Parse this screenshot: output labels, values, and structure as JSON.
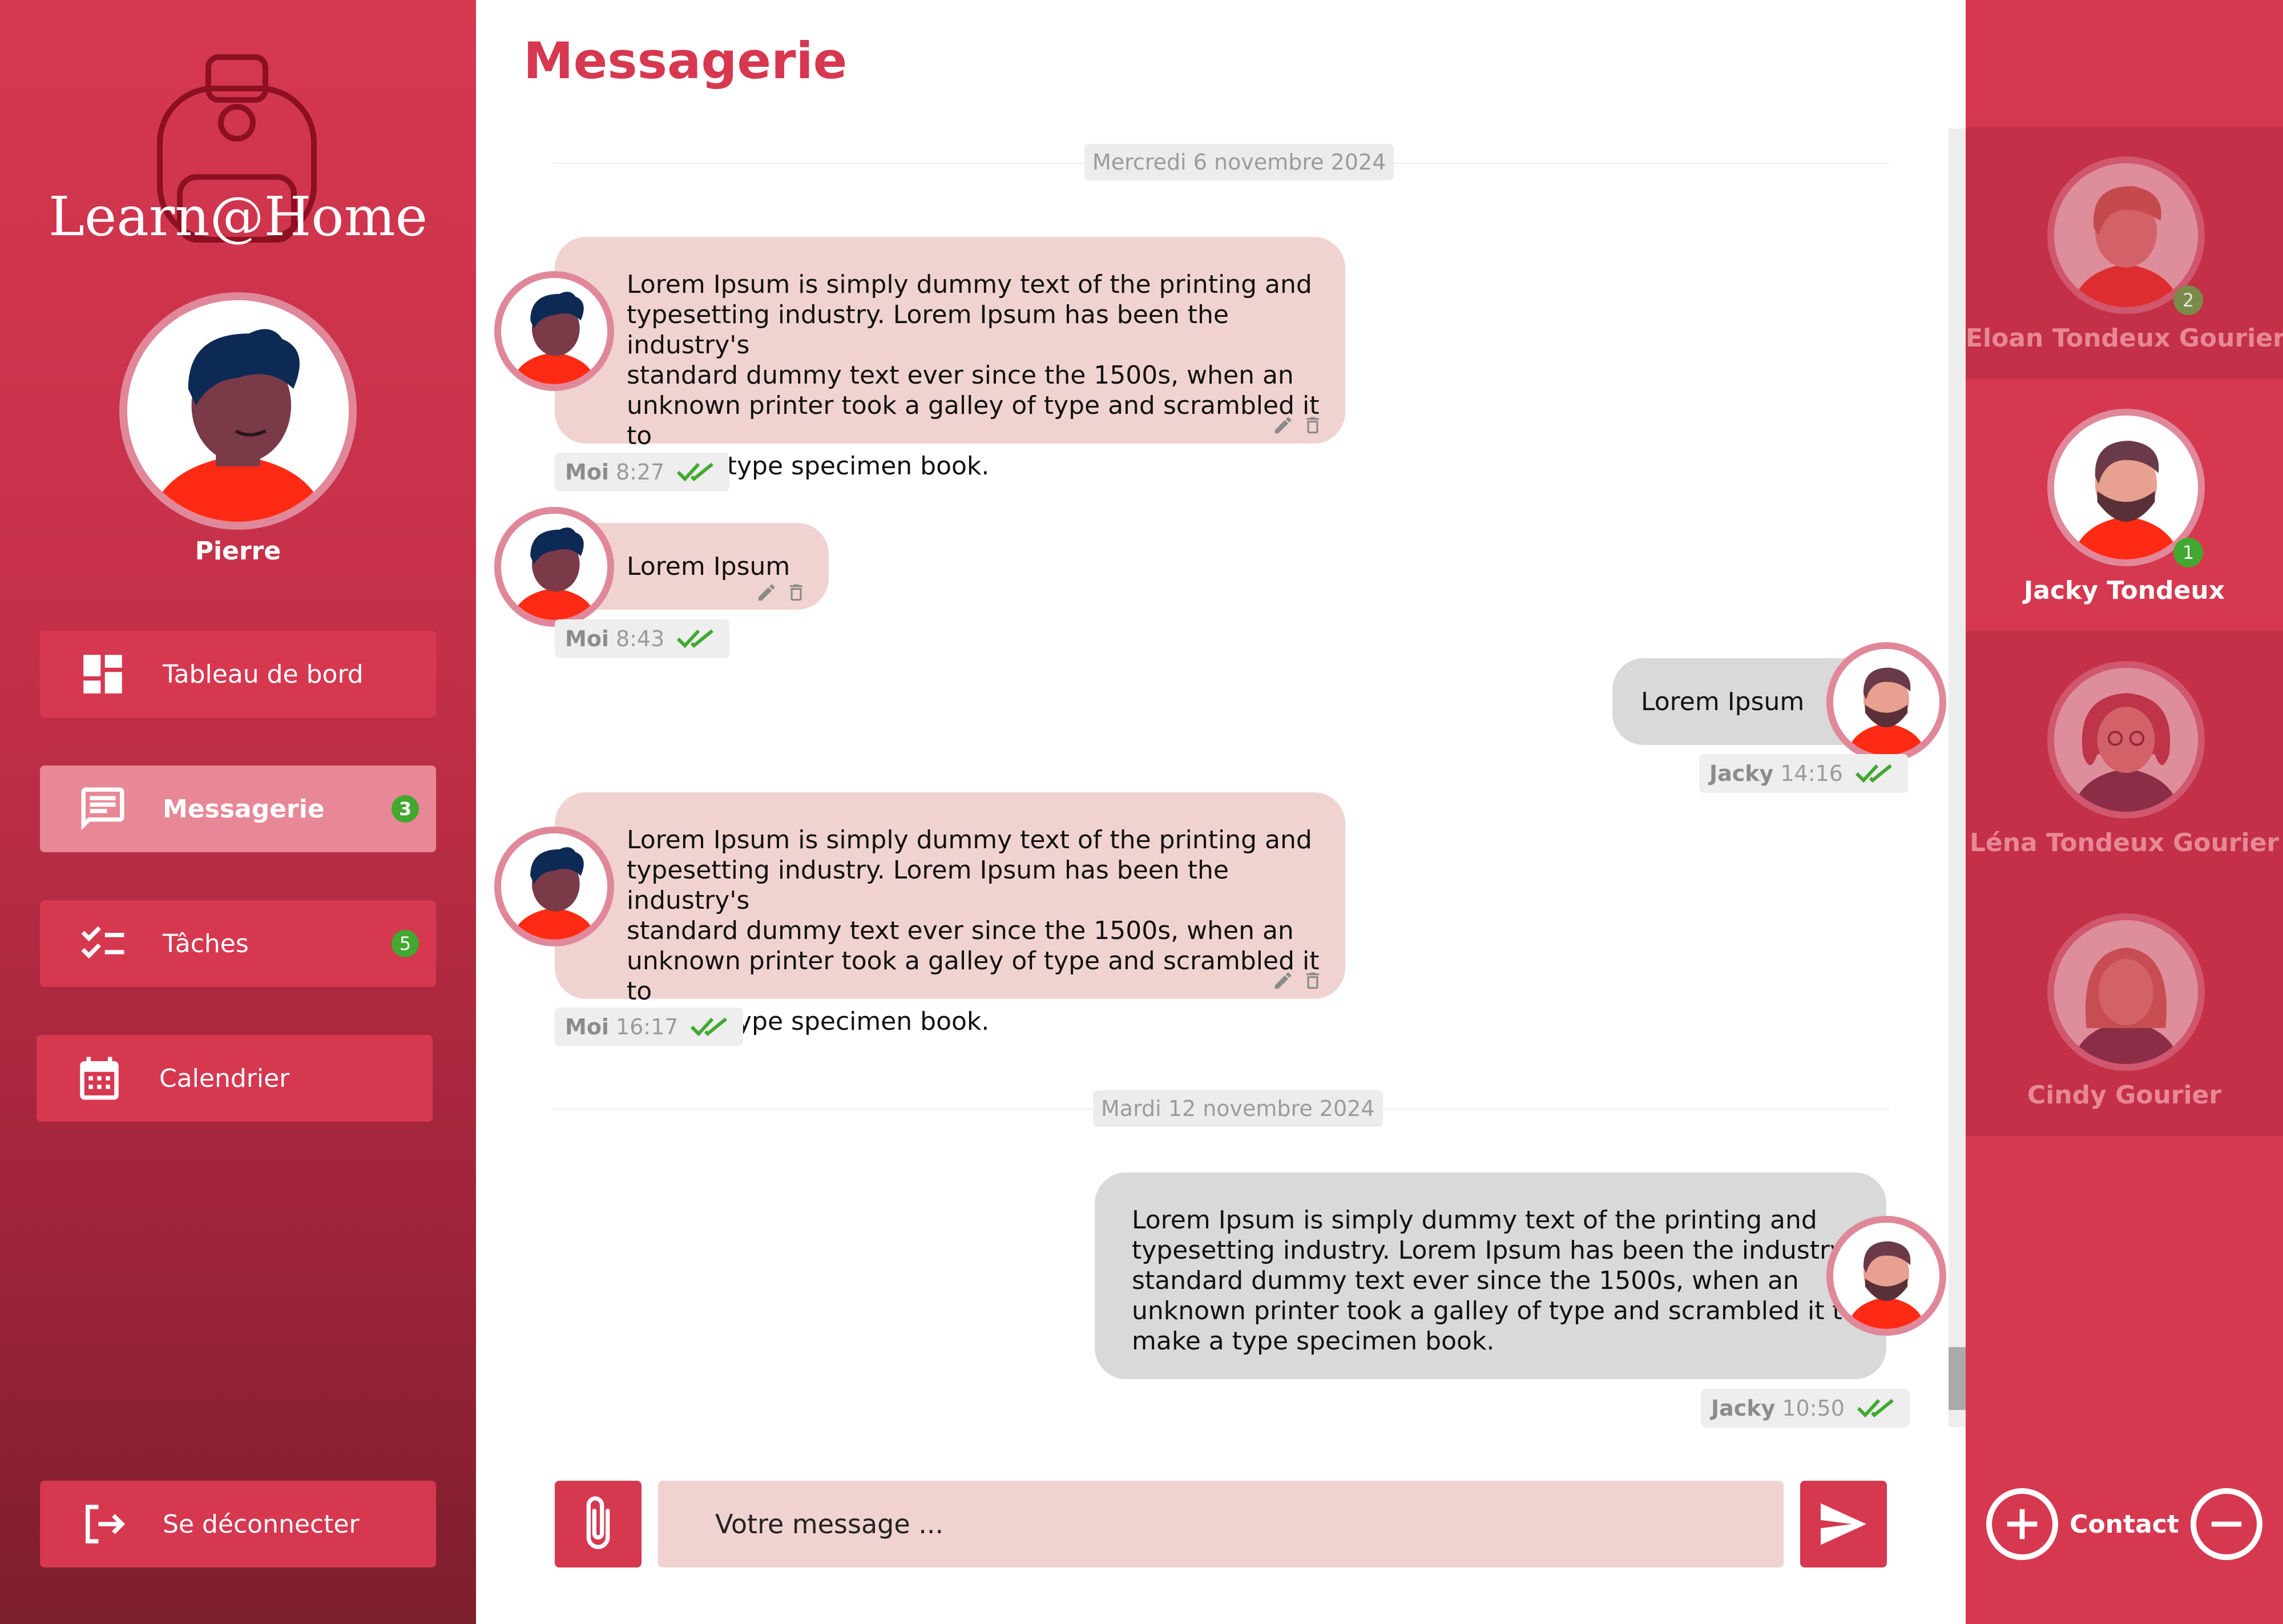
{
  "app": {
    "name": "Learn@Home"
  },
  "user": {
    "name": "Pierre"
  },
  "nav": {
    "items": [
      {
        "label": "Tableau de bord",
        "icon": "dashboard-icon",
        "badge": ""
      },
      {
        "label": "Messagerie",
        "icon": "chat-icon",
        "badge": "3",
        "active": true
      },
      {
        "label": "Tâches",
        "icon": "tasks-icon",
        "badge": "5"
      },
      {
        "label": "Calendrier",
        "icon": "calendar-icon",
        "badge": ""
      }
    ],
    "logout_label": "Se déconnecter"
  },
  "page": {
    "title": "Messagerie"
  },
  "conversation": {
    "dates": [
      "Mercredi 6 novembre 2024",
      "Mardi 12 novembre 2024"
    ],
    "messages": [
      {
        "from": "me",
        "author": "Moi",
        "time": "8:27",
        "lines": [
          "Lorem Ipsum is simply dummy text of the printing and",
          "typesetting industry. Lorem Ipsum has been the industry's",
          "standard dummy text ever since the 1500s, when an",
          "unknown printer took a galley of  type and scrambled it to",
          "make a type specimen book."
        ]
      },
      {
        "from": "me",
        "author": "Moi",
        "time": "8:43",
        "lines": [
          "Lorem Ipsum"
        ]
      },
      {
        "from": "contact",
        "author": "Jacky",
        "time": "14:16",
        "lines": [
          "Lorem Ipsum"
        ]
      },
      {
        "from": "me",
        "author": "Moi",
        "time": "16:17",
        "lines": [
          "Lorem Ipsum is simply dummy text of the printing and",
          "typesetting industry. Lorem Ipsum has been the industry's",
          "standard dummy text ever since the 1500s, when an",
          "unknown printer took a galley of  type and scrambled it to",
          "make a type specimen book."
        ]
      },
      {
        "from": "contact",
        "author": "Jacky",
        "time": "10:50",
        "lines": [
          "Lorem Ipsum is simply dummy text of the printing and",
          "typesetting industry. Lorem Ipsum has been the industry's",
          "standard dummy text ever since the 1500s, when an",
          "unknown printer took a galley of  type and scrambled it to",
          "make a type specimen book."
        ]
      }
    ]
  },
  "composer": {
    "placeholder": "Votre message ..."
  },
  "contacts": {
    "items": [
      {
        "name": "Eloan Tondeux Gourier",
        "badge": "2",
        "active": false
      },
      {
        "name": "Jacky Tondeux",
        "badge": "1",
        "active": true
      },
      {
        "name": "Léna Tondeux Gourier",
        "badge": "",
        "active": false
      },
      {
        "name": "Cindy Gourier",
        "badge": "",
        "active": false
      }
    ],
    "footer_label": "Contact"
  },
  "colors": {
    "primary": "#d63850",
    "active_nav": "#e88795",
    "incoming_bubble": "#f0d3d0",
    "outgoing_bubble": "#d9d9d9",
    "badge": "#42a830",
    "read_check": "#42a830"
  }
}
